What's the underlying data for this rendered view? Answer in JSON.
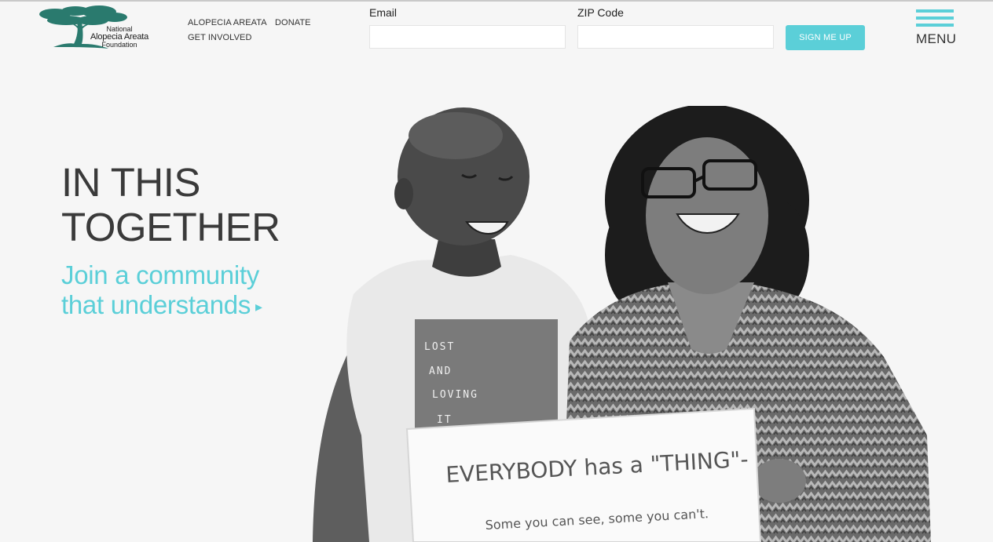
{
  "header": {
    "logo": {
      "line1": "National",
      "line2": "Alopecia Areata",
      "line3": "Foundation"
    },
    "nav": {
      "alopecia_areata": "ALOPECIA AREATA",
      "donate": "DONATE",
      "get_involved": "GET INVOLVED"
    },
    "signup_form": {
      "email_label": "Email",
      "email_value": "",
      "zip_label": "ZIP Code",
      "zip_value": "",
      "submit_label": "SIGN ME UP"
    },
    "menu_label": "MENU"
  },
  "hero": {
    "headline_line1": "IN THIS",
    "headline_line2": "TOGETHER",
    "cta_line1": "Join a community",
    "cta_line2": "that understands",
    "cta_arrow": "▸",
    "photo": {
      "shirt_text": [
        "LOST",
        "AND",
        "LOVING",
        "IT"
      ],
      "sign_line1": "EVERYBODY has a \"THING\"-",
      "sign_line2": "Some you can see, some you can't."
    }
  },
  "colors": {
    "accent": "#5bcfd8",
    "logo_green": "#2a7a6e",
    "background": "#f6f6f6",
    "headline": "#3a3a3a"
  },
  "icons": {
    "logo": "tree-logo-icon",
    "menu": "hamburger-menu-icon",
    "cta_arrow": "play-arrow-icon"
  }
}
